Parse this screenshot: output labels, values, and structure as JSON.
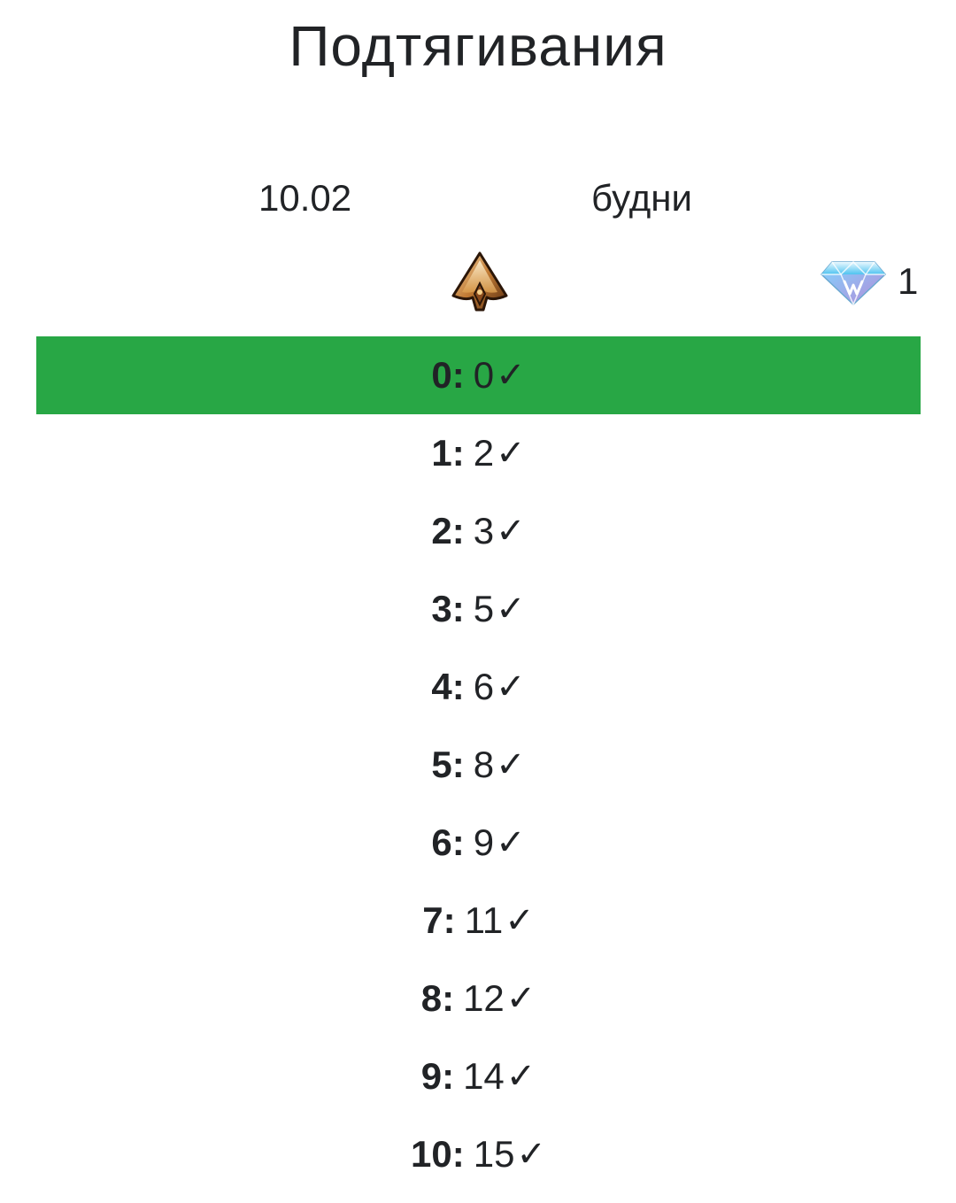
{
  "title": "Подтягивания",
  "info": {
    "date": "10.02",
    "day_type": "будни"
  },
  "rank_icon": "rank-emblem-icon",
  "gems": {
    "icon": "diamond-icon",
    "count": "1"
  },
  "colors": {
    "active_row": "#28a745",
    "text": "#212326"
  },
  "sets": [
    {
      "index": "0",
      "value": "0",
      "check": "✓",
      "active": true
    },
    {
      "index": "1",
      "value": "2",
      "check": "✓",
      "active": false
    },
    {
      "index": "2",
      "value": "3",
      "check": "✓",
      "active": false
    },
    {
      "index": "3",
      "value": "5",
      "check": "✓",
      "active": false
    },
    {
      "index": "4",
      "value": "6",
      "check": "✓",
      "active": false
    },
    {
      "index": "5",
      "value": "8",
      "check": "✓",
      "active": false
    },
    {
      "index": "6",
      "value": "9",
      "check": "✓",
      "active": false
    },
    {
      "index": "7",
      "value": "11",
      "check": "✓",
      "active": false
    },
    {
      "index": "8",
      "value": "12",
      "check": "✓",
      "active": false
    },
    {
      "index": "9",
      "value": "14",
      "check": "✓",
      "active": false
    },
    {
      "index": "10",
      "value": "15",
      "check": "✓",
      "active": false
    }
  ]
}
